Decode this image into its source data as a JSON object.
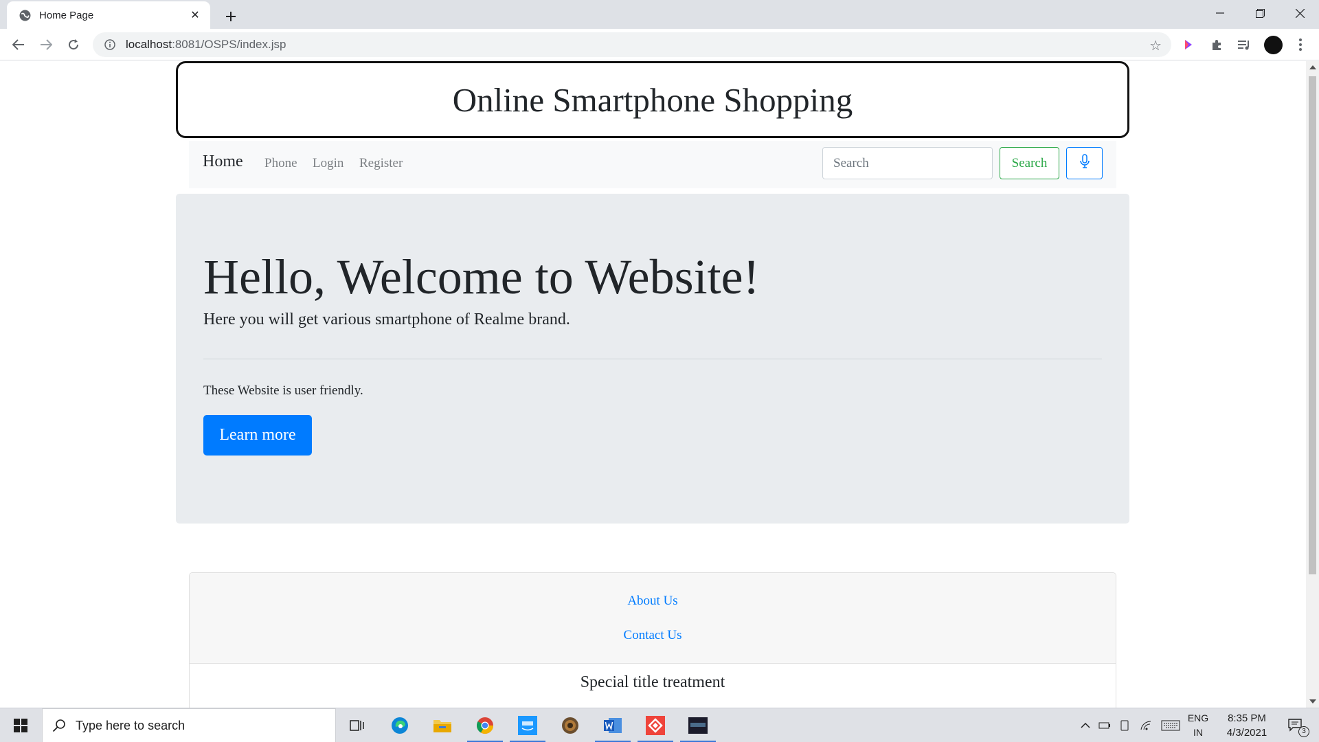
{
  "browser": {
    "tab_title": "Home Page",
    "url_host": "localhost",
    "url_rest": ":8081/OSPS/index.jsp"
  },
  "page": {
    "header_title": "Online Smartphone Shopping",
    "navbar": {
      "brand": "Home",
      "links": [
        "Phone",
        "Login",
        "Register"
      ],
      "search_placeholder": "Search",
      "search_button": "Search"
    },
    "jumbotron": {
      "title": "Hello, Welcome to Website!",
      "lead": "Here you will get various smartphone of Realme brand.",
      "text": "These Website is user friendly.",
      "button": "Learn more"
    },
    "footer": {
      "links": [
        "About Us",
        "Contact Us"
      ],
      "special_title": "Special title treatment"
    }
  },
  "taskbar": {
    "search_placeholder": "Type here to search",
    "lang_line1": "ENG",
    "lang_line2": "IN",
    "time": "8:35 PM",
    "date": "4/3/2021",
    "notification_count": "3"
  },
  "colors": {
    "primary": "#007bff",
    "success": "#28a745",
    "jumbotron_bg": "#e9ecef",
    "navbar_bg": "#f8f9fa"
  }
}
